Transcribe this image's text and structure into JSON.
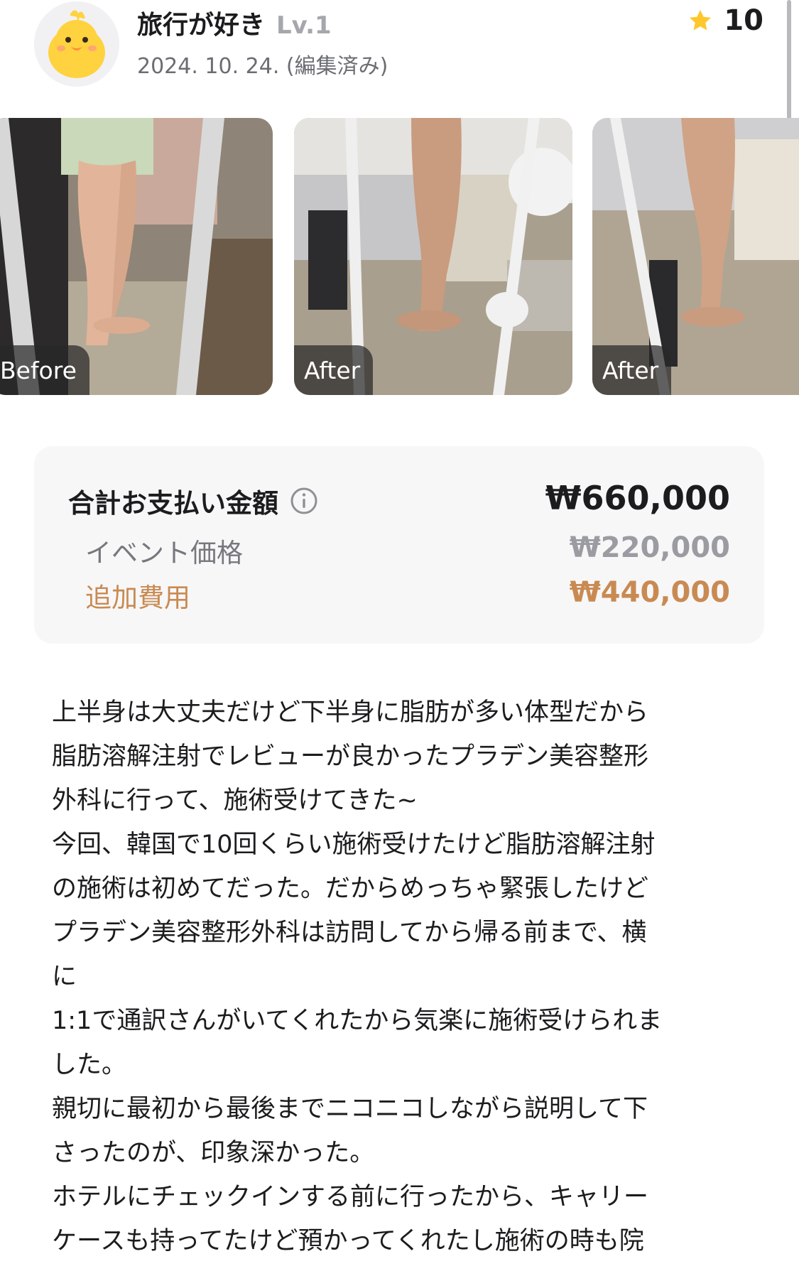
{
  "user": {
    "name": "旅行が好き",
    "level": "Lv.1",
    "date": "2024. 10. 24. (編集済み)",
    "rating": "10",
    "avatar_icon": "chick-avatar-icon",
    "star_icon": "star-icon"
  },
  "photos": [
    {
      "tag": "Before"
    },
    {
      "tag": "After"
    },
    {
      "tag": "After"
    }
  ],
  "price": {
    "total_label": "合計お支払い金額",
    "total_value": "₩660,000",
    "event_label": "イベント価格",
    "event_value": "₩220,000",
    "extra_label": "追加費用",
    "extra_value": "₩440,000",
    "accent_color": "#c98a52"
  },
  "review_lines": [
    "上半身は大丈夫だけど下半身に脂肪が多い体型だから",
    "脂肪溶解注射でレビューが良かったプラデン美容整形",
    "外科に行って、施術受けてきた~",
    "今回、韓国で10回くらい施術受けたけど脂肪溶解注射",
    "の施術は初めてだった。だからめっちゃ緊張したけど",
    "プラデン美容整形外科は訪問してから帰る前まで、横",
    "に",
    "1:1で通訳さんがいてくれたから気楽に施術受けられま",
    "した。",
    "親切に最初から最後までニコニコしながら説明して下",
    "さったのが、印象深かった。",
    "ホテルにチェックインする前に行ったから、キャリー",
    "ケースも持ってたけど預かってくれたし施術の時も院"
  ]
}
